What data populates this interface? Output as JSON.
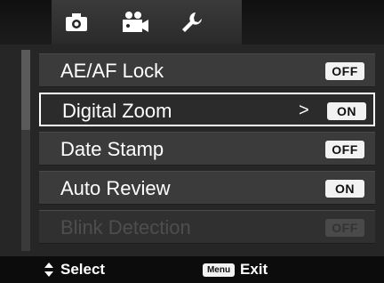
{
  "tabs": [
    {
      "icon": "camera-icon"
    },
    {
      "icon": "video-camera-icon"
    },
    {
      "icon": "wrench-icon"
    }
  ],
  "menu_items": [
    {
      "label": "AE/AF Lock",
      "value": "OFF",
      "selected": false,
      "enabled": true
    },
    {
      "label": "Digital Zoom",
      "value": "ON",
      "selected": true,
      "enabled": true,
      "arrow": ">"
    },
    {
      "label": "Date Stamp",
      "value": "OFF",
      "selected": false,
      "enabled": true
    },
    {
      "label": "Auto Review",
      "value": "ON",
      "selected": false,
      "enabled": true
    },
    {
      "label": "Blink Detection",
      "value": "OFF",
      "selected": false,
      "enabled": false
    }
  ],
  "bottom": {
    "select_icon": "up-down-arrows-icon",
    "select_label": "Select",
    "menu_key": "Menu",
    "exit_label": "Exit"
  }
}
